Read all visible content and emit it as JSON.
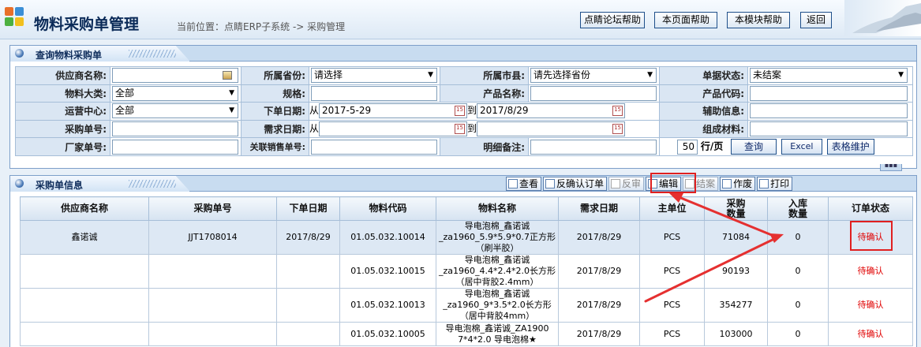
{
  "header": {
    "title": "物料采购单管理",
    "location": "当前位置：点睛ERP子系统  ->  采购管理",
    "buttons": [
      "点睛论坛帮助",
      "本页面帮助",
      "本模块帮助",
      "返回"
    ]
  },
  "query": {
    "panel_title": "查询物料采购单",
    "rows": [
      {
        "l1": "供应商名称:",
        "v1": "",
        "l2": "所属省份:",
        "v2": "请选择",
        "l3": "所属市县:",
        "v3": "请先选择省份",
        "l4": "单据状态:",
        "v4": "未结案"
      },
      {
        "l1": "物料大类:",
        "v1": "全部",
        "l2": "规格:",
        "v2": "",
        "l3": "产品名称:",
        "v3": "",
        "l4": "产品代码:",
        "v4": ""
      },
      {
        "l1": "运营中心:",
        "v1": "全部",
        "l2": "下单日期:",
        "v2a": "2017-5-29",
        "v2b": "2017/8/29",
        "l4": "辅助信息:",
        "v4": ""
      },
      {
        "l1": "采购单号:",
        "v1": "",
        "l2": "需求日期:",
        "v2a": "",
        "v2b": "",
        "l4": "组成材料:",
        "v4": ""
      },
      {
        "l1": "厂家单号:",
        "v1": "",
        "l2": "关联销售单号:",
        "v2": "",
        "l3": "明细备注:",
        "v3": "",
        "page_size": "50",
        "page_unit": "行/页"
      }
    ],
    "from_label": "从",
    "to_label": "到",
    "query_button": "查询",
    "excel_button": "Excel",
    "maintain_button": "表格维护"
  },
  "list": {
    "panel_title": "采购单信息",
    "toolbar": [
      "查看",
      "反确认订单",
      "反审",
      "编辑",
      "结案",
      "作废",
      "打印"
    ],
    "columns": [
      "供应商名称",
      "采购单号",
      "下单日期",
      "物料代码",
      "物料名称",
      "需求日期",
      "主单位",
      "采购\n数量",
      "入库\n数量",
      "订单状态"
    ],
    "rows": [
      {
        "supplier": "鑫诺诚",
        "order_no": "JJT1708014",
        "order_date": "2017/8/29",
        "code": "01.05.032.10014",
        "name": "导电泡棉_鑫诺诚\n_za1960_5.9*5.9*0.7正方形\n（刷半胶）",
        "need_date": "2017/8/29",
        "unit": "PCS",
        "qty": "71084",
        "in_qty": "0",
        "status": "待确认"
      },
      {
        "supplier": "",
        "order_no": "",
        "order_date": "",
        "code": "01.05.032.10015",
        "name": "导电泡棉_鑫诺诚\n_za1960_4.4*2.4*2.0长方形\n（居中背胶2.4mm）",
        "need_date": "2017/8/29",
        "unit": "PCS",
        "qty": "90193",
        "in_qty": "0",
        "status": "待确认"
      },
      {
        "supplier": "",
        "order_no": "",
        "order_date": "",
        "code": "01.05.032.10013",
        "name": "导电泡棉_鑫诺诚\n_za1960_9*3.5*2.0长方形\n（居中背胶4mm）",
        "need_date": "2017/8/29",
        "unit": "PCS",
        "qty": "354277",
        "in_qty": "0",
        "status": "待确认"
      },
      {
        "supplier": "",
        "order_no": "",
        "order_date": "",
        "code": "01.05.032.10005",
        "name": "导电泡棉_鑫诺诚_ZA1900\n7*4*2.0 导电泡棉★",
        "need_date": "2017/8/29",
        "unit": "PCS",
        "qty": "103000",
        "in_qty": "0",
        "status": "待确认"
      }
    ]
  },
  "icons": {
    "logo": "colored-squares-logo",
    "calendar": "calendar-icon",
    "picker": "picker-icon",
    "arrow": "annotation-arrow"
  }
}
